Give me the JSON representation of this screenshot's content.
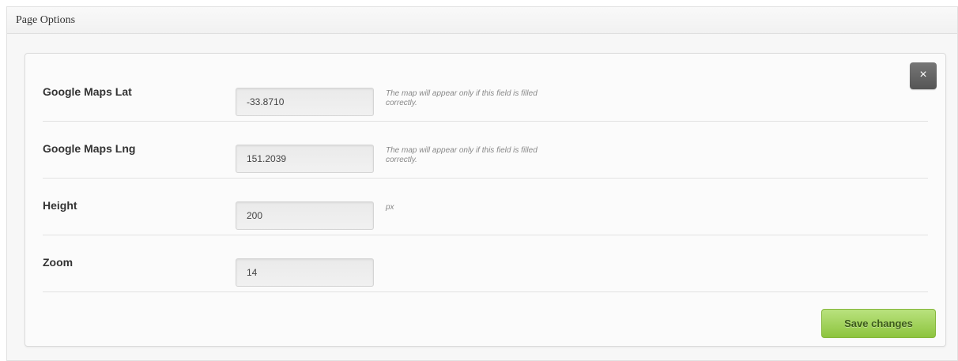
{
  "panel": {
    "title": "Page Options"
  },
  "close_button": {
    "label": "×"
  },
  "fields": [
    {
      "label": "Google Maps Lat",
      "value": "-33.8710",
      "hint": "The map will appear only if this field is filled correctly."
    },
    {
      "label": "Google Maps Lng",
      "value": "151.2039",
      "hint": "The map will appear only if this field is filled correctly."
    },
    {
      "label": "Height",
      "value": "200",
      "hint": "px"
    },
    {
      "label": "Zoom",
      "value": "14",
      "hint": ""
    }
  ],
  "save_button": {
    "label": "Save changes",
    "color": "#8dc43e"
  }
}
